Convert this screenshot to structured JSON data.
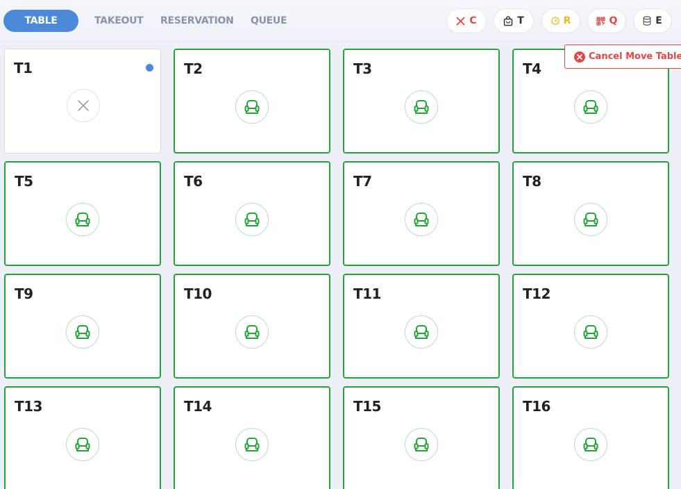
{
  "nav": {
    "tabs": [
      {
        "label": "TABLE",
        "active": true
      },
      {
        "label": "TAKEOUT",
        "active": false
      },
      {
        "label": "RESERVATION",
        "active": false
      },
      {
        "label": "QUEUE",
        "active": false
      }
    ]
  },
  "toolbar": {
    "filters": [
      {
        "icon": "close-icon",
        "label": "C",
        "color": "#e04848"
      },
      {
        "icon": "bag-icon",
        "label": "T",
        "color": "#333333"
      },
      {
        "icon": "clock-icon",
        "label": "R",
        "color": "#e8b923"
      },
      {
        "icon": "qr-code-icon",
        "label": "Q",
        "color": "#e04848"
      },
      {
        "icon": "database-icon",
        "label": "E",
        "color": "#333333"
      }
    ]
  },
  "cancel_move": {
    "label": "Cancel Move Table",
    "color": "#e04848"
  },
  "tables": [
    {
      "label": "T1",
      "status": "current"
    },
    {
      "label": "T2",
      "status": "available"
    },
    {
      "label": "T3",
      "status": "available"
    },
    {
      "label": "T4",
      "status": "available"
    },
    {
      "label": "T5",
      "status": "available"
    },
    {
      "label": "T6",
      "status": "available"
    },
    {
      "label": "T7",
      "status": "available"
    },
    {
      "label": "T8",
      "status": "available"
    },
    {
      "label": "T9",
      "status": "available"
    },
    {
      "label": "T10",
      "status": "available"
    },
    {
      "label": "T11",
      "status": "available"
    },
    {
      "label": "T12",
      "status": "available"
    },
    {
      "label": "T13",
      "status": "available"
    },
    {
      "label": "T14",
      "status": "available"
    },
    {
      "label": "T15",
      "status": "available"
    },
    {
      "label": "T16",
      "status": "available"
    }
  ],
  "colors": {
    "accent": "#4a8ad8",
    "available": "#25a33a",
    "danger": "#e04848"
  }
}
